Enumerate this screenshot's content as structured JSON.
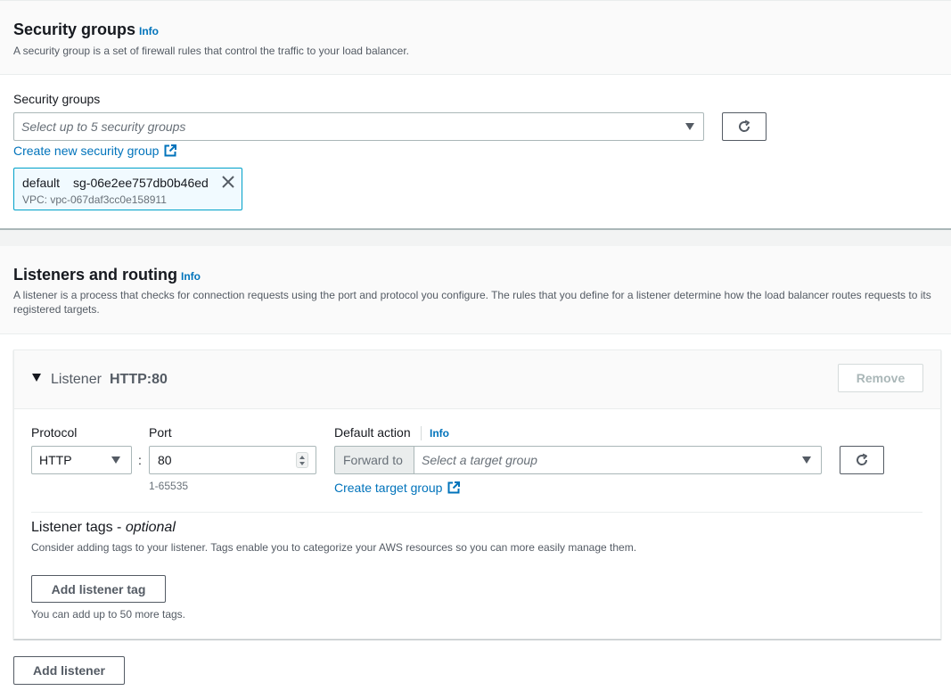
{
  "security_groups": {
    "title": "Security groups",
    "info": "Info",
    "description": "A security group is a set of firewall rules that control the traffic to your load balancer.",
    "field_label": "Security groups",
    "select_placeholder": "Select up to 5 security groups",
    "create_link": "Create new security group",
    "selected_token": {
      "name": "default",
      "id": "sg-06e2ee757db0b46ed",
      "vpc": "VPC: vpc-067daf3cc0e158911"
    }
  },
  "listeners": {
    "title": "Listeners and routing",
    "info": "Info",
    "description": "A listener is a process that checks for connection requests using the port and protocol you configure. The rules that you define for a listener determine how the load balancer routes requests to its registered targets.",
    "listener": {
      "label": "Listener",
      "name": "HTTP:80",
      "remove_label": "Remove",
      "protocol_label": "Protocol",
      "protocol_value": "HTTP",
      "port_label": "Port",
      "port_value": "80",
      "port_range": "1-65535",
      "separator": ":",
      "default_action_label": "Default action",
      "default_action_info": "Info",
      "forward_to": "Forward to",
      "target_placeholder": "Select a target group",
      "create_target_link": "Create target group",
      "tags_title": "Listener tags - ",
      "tags_optional": "optional",
      "tags_description": "Consider adding tags to your listener. Tags enable you to categorize your AWS resources so you can more easily manage them.",
      "add_tag_label": "Add listener tag",
      "tags_limit": "You can add up to 50 more tags."
    },
    "add_listener_label": "Add listener"
  },
  "colors": {
    "link": "#0073bb",
    "token_bg": "#f1faff",
    "token_border": "#00a1c9"
  }
}
